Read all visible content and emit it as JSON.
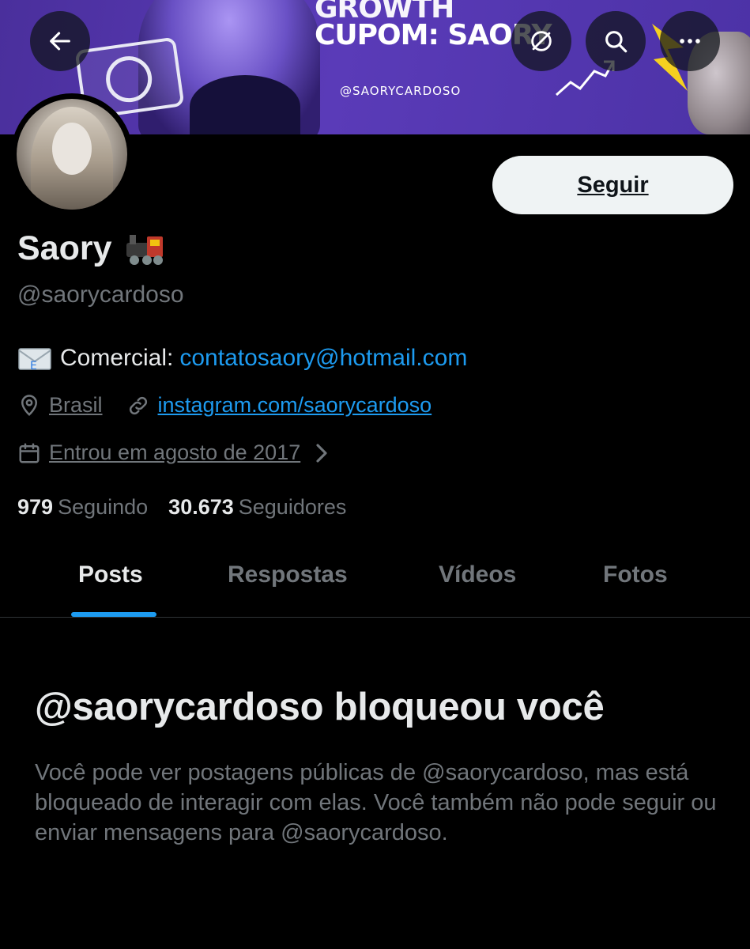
{
  "banner": {
    "headline_line1": "GROWTH",
    "headline_line2": "CUPOM: SAORY",
    "handle": "@SAORYCARDOSO"
  },
  "header_buttons": {
    "back": "arrow-left-icon",
    "unblock": "slash-icon",
    "search": "search-icon",
    "more": "more-icon"
  },
  "profile": {
    "display_name": "Saory",
    "name_emoji": "🚂",
    "handle": "@saorycardoso",
    "follow_label": "Seguir",
    "bio": {
      "emoji": "📧",
      "label": "Comercial:",
      "link": "contatosaory@hotmail.com"
    },
    "location": "Brasil",
    "website": "instagram.com/saorycardoso",
    "joined": "Entrou em agosto de 2017",
    "following_count": "979",
    "following_label": "Seguindo",
    "followers_count": "30.673",
    "followers_label": "Seguidores"
  },
  "tabs": [
    {
      "label": "Posts",
      "active": true
    },
    {
      "label": "Respostas",
      "active": false
    },
    {
      "label": "Vídeos",
      "active": false
    },
    {
      "label": "Fotos",
      "active": false
    }
  ],
  "blocked": {
    "title": "@saorycardoso bloqueou você",
    "body": "Você pode ver postagens públicas de @saorycardoso, mas está bloqueado de interagir com elas. Você também não pode seguir ou enviar mensagens para @saorycardoso."
  },
  "colors": {
    "accent": "#1d9bf0",
    "text_primary": "#e7e9ea",
    "text_secondary": "#71767b",
    "background": "#000000",
    "banner": "#5a3bb8"
  }
}
